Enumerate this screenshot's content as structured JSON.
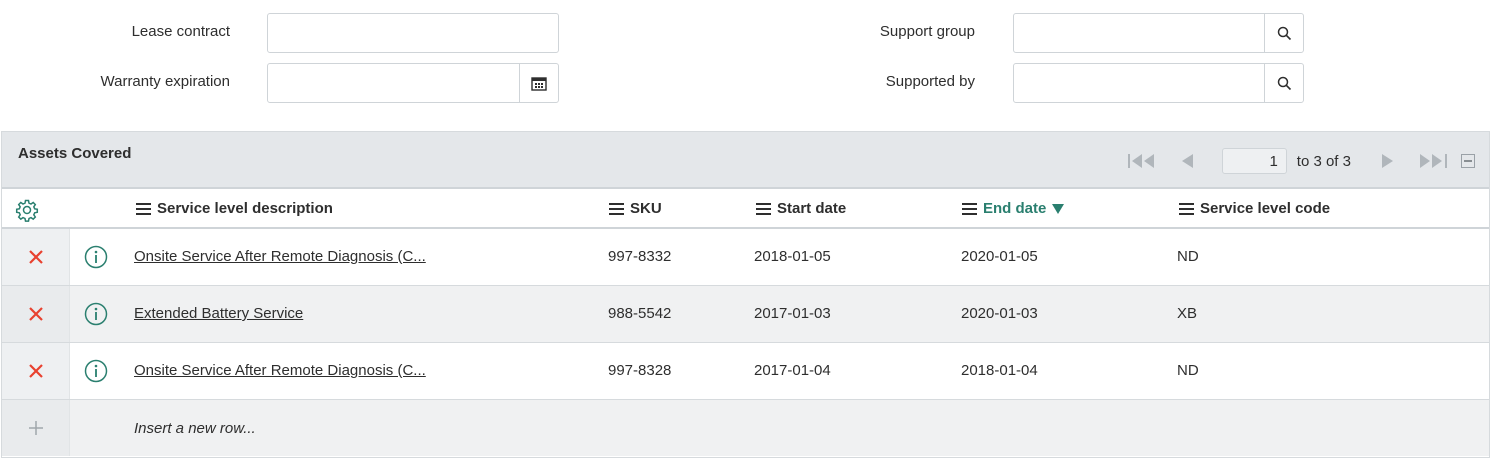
{
  "form": {
    "lease_contract": {
      "label": "Lease contract",
      "value": ""
    },
    "warranty_expiration": {
      "label": "Warranty expiration",
      "value": ""
    },
    "support_group": {
      "label": "Support group",
      "value": ""
    },
    "supported_by": {
      "label": "Supported by",
      "value": ""
    }
  },
  "assets_covered": {
    "title": "Assets Covered",
    "pager": {
      "page": "1",
      "range_text": "to 3 of 3"
    },
    "columns": [
      {
        "label": "Service level description"
      },
      {
        "label": "SKU"
      },
      {
        "label": "Start date"
      },
      {
        "label": "End date",
        "sort": "descending"
      },
      {
        "label": "Service level code"
      }
    ],
    "rows": [
      {
        "description": "Onsite Service After Remote Diagnosis (C...",
        "sku": "997-8332",
        "start_date": "2018-01-05",
        "end_date": "2020-01-05",
        "code": "ND"
      },
      {
        "description": "Extended Battery Service",
        "sku": "988-5542",
        "start_date": "2017-01-03",
        "end_date": "2020-01-03",
        "code": "XB"
      },
      {
        "description": "Onsite Service After Remote Diagnosis (C...",
        "sku": "997-8328",
        "start_date": "2017-01-04",
        "end_date": "2018-01-04",
        "code": "ND"
      }
    ],
    "insert_text": "Insert a new row..."
  },
  "icons": {
    "settings": "gear-icon",
    "delete": "x-icon",
    "info": "info-icon",
    "search": "search-icon",
    "calendar": "calendar-icon",
    "add": "plus-icon",
    "first": "first-page-icon",
    "prev": "prev-page-icon",
    "next": "next-page-icon",
    "last": "last-page-icon",
    "collapse": "collapse-icon"
  },
  "colors": {
    "delete": "#e8412f",
    "accent": "#2a7f6f",
    "header_bg": "#e4e7ea"
  }
}
